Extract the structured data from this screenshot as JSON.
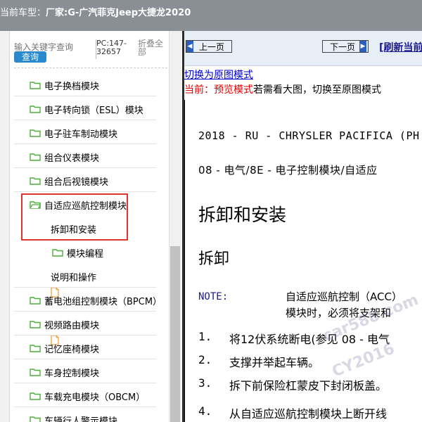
{
  "header": {
    "label": "当前车型：",
    "vehicle": "厂家:G-广汽菲克Jeep大捷龙2020"
  },
  "sidebar": {
    "search_placeholder": "输入关键字查询",
    "search_button": "查询",
    "pc_code": "PC:147-32657",
    "collapse_all": "折叠全部",
    "items": [
      {
        "label": "电子换档模块",
        "icon": "folder-icon"
      },
      {
        "label": "电子转向锁（ESL）模块",
        "icon": "folder-icon"
      },
      {
        "label": "电子驻车制动模块",
        "icon": "folder-icon"
      },
      {
        "label": "组合仪表模块",
        "icon": "folder-icon"
      },
      {
        "label": "组合后视镜模块",
        "icon": "folder-icon"
      },
      {
        "label": "自适应巡航控制模块",
        "icon": "folder-open-icon"
      },
      {
        "label": "拆卸和安装",
        "icon": "document-icon"
      },
      {
        "label": "模块编程",
        "icon": "folder-icon"
      },
      {
        "label": "说明和操作",
        "icon": "document-icon"
      },
      {
        "label": "蓄电池组控制模块（BPCM）",
        "icon": "folder-icon"
      },
      {
        "label": "视频路由模块",
        "icon": "folder-icon"
      },
      {
        "label": "记忆座椅模块",
        "icon": "folder-icon"
      },
      {
        "label": "车身控制模块",
        "icon": "folder-icon"
      },
      {
        "label": "车载充电模块（OBCM）",
        "icon": "folder-icon"
      },
      {
        "label": "车辆行人警示模块",
        "icon": "folder-icon"
      }
    ]
  },
  "viewer": {
    "prev_label": "上一页",
    "next_label": "下一页",
    "refresh_label": "[刷新当前",
    "switch_link": "切换为原图模式",
    "current_prefix": "当前：预览模式",
    "current_suffix": "若需看大图，切换至原图模式"
  },
  "document": {
    "header_line": "2018 - RU - CHRYSLER PACIFICA (PH",
    "section_line": "08 - 电气/8E - 电子控制模块/自适应",
    "title": "拆卸和安装",
    "subtitle": "拆卸",
    "note_label": "NOTE:",
    "note_line1": "自适应巡航控制（ACC）",
    "note_line2": "模块时，必须将支架和",
    "steps": [
      {
        "num": "1.",
        "text": "将12伏系统断电(参见 08 - 电气"
      },
      {
        "num": "2.",
        "text": "支撑并举起车辆。"
      },
      {
        "num": "3.",
        "text": "拆下前保险杠蒙皮下封闭板盖。"
      },
      {
        "num": "4.",
        "text": "从自适应巡航控制模块上断开线"
      }
    ],
    "watermark1": "car588.com",
    "watermark2": "CY2016"
  },
  "colors": {
    "topbar": "#8a8f96",
    "search_button": "#2a89cc",
    "highlight": "#e0322e",
    "folder": "#4caf3a",
    "document": "#f0a040",
    "link": "#0000cc",
    "current_red": "#e00000"
  }
}
